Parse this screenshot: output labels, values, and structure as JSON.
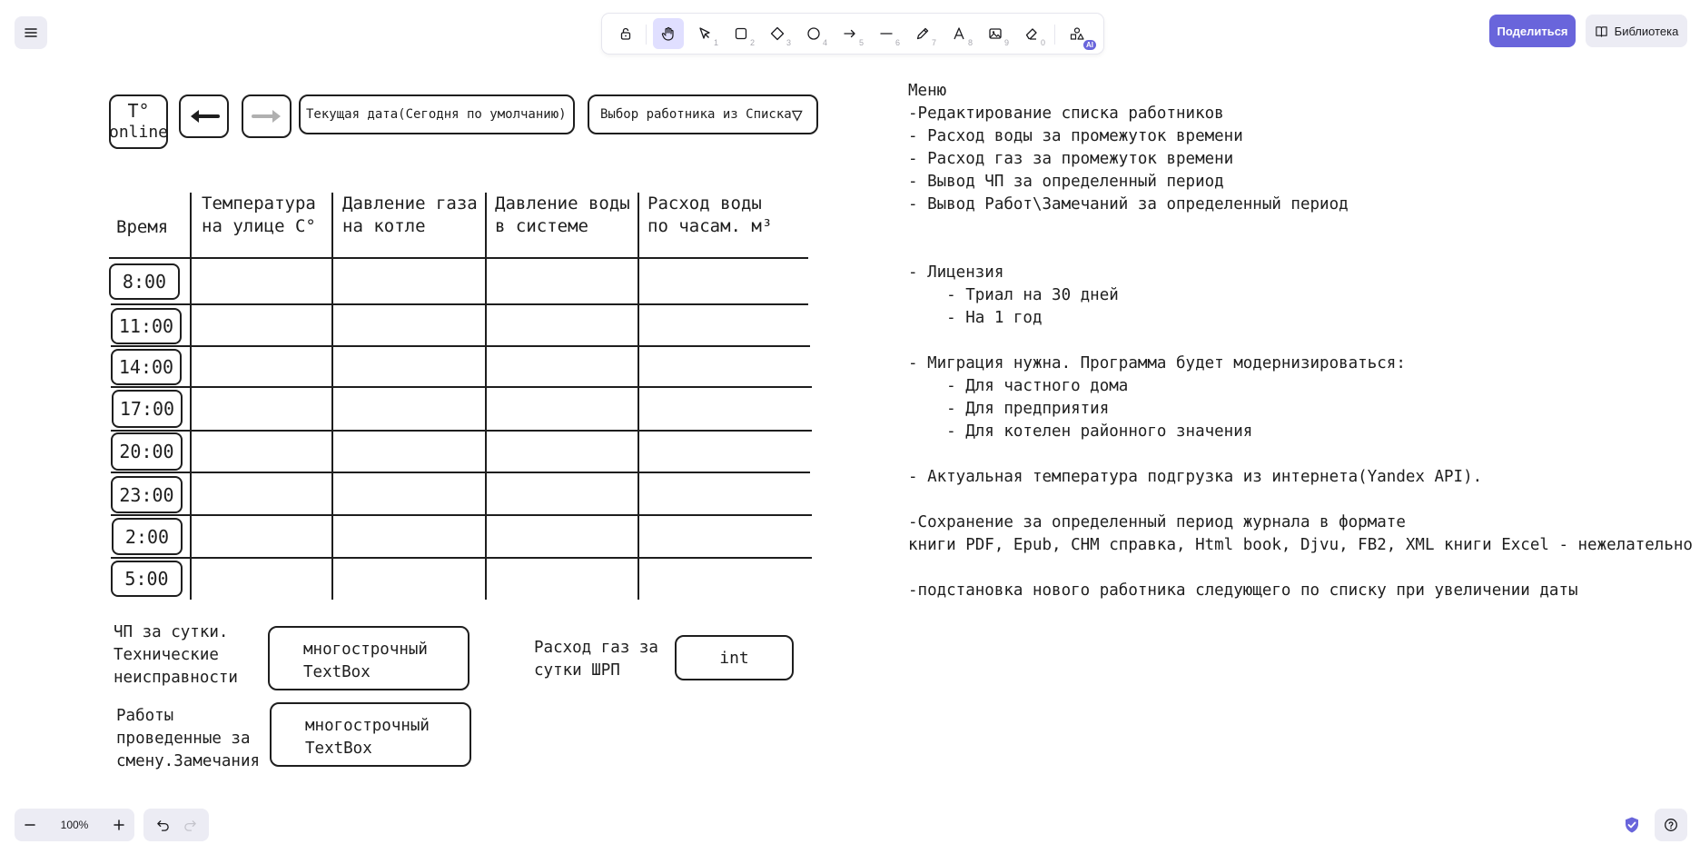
{
  "app": {
    "share_label": "Поделиться",
    "library_label": "Библиотека",
    "zoom": "100%",
    "accent": "#6965db"
  },
  "toolbar": {
    "tools": [
      {
        "name": "lock-icon",
        "key": ""
      },
      {
        "name": "hand-icon",
        "key": ""
      },
      {
        "name": "select-icon",
        "key": "1"
      },
      {
        "name": "rectangle-icon",
        "key": "2"
      },
      {
        "name": "diamond-icon",
        "key": "3"
      },
      {
        "name": "ellipse-icon",
        "key": "4"
      },
      {
        "name": "arrow-icon",
        "key": "5"
      },
      {
        "name": "line-icon",
        "key": "6"
      },
      {
        "name": "pencil-icon",
        "key": "7"
      },
      {
        "name": "text-icon",
        "key": "8"
      },
      {
        "name": "image-icon",
        "key": "9"
      },
      {
        "name": "eraser-icon",
        "key": "0"
      },
      {
        "name": "shapes-ai-icon",
        "key": ""
      }
    ],
    "ai_badge": "AI"
  },
  "canvas": {
    "top_controls": {
      "temp_online_line1": "T°",
      "temp_online_line2": "online",
      "date_field": "Текущая дата(Сегодня по умолчанию)",
      "worker_select": "Выбор работника из Списка",
      "worker_select_arrow": "▽"
    },
    "table": {
      "headers": [
        "Время",
        "Температура\nна улице C°",
        "Давление газа\nна котле",
        "Давление воды\nв системе",
        "Расход воды\nпо часам. м³"
      ],
      "times": [
        "8:00",
        "11:00",
        "14:00",
        "17:00",
        "20:00",
        "23:00",
        "2:00",
        "5:00"
      ]
    },
    "bottom": {
      "incidents_label": "ЧП за сутки.\nТехнические\nнеисправности",
      "incidents_box": "многострочный\nTextBox",
      "works_label": "Работы\nпроведенные за\nсмену.Замечания",
      "works_box": "многострочный\nTextBox",
      "gas_label": "Расход газ за\nсутки ШРП",
      "gas_box": "int"
    },
    "notes": [
      "Меню",
      "-Редактирование списка работников",
      "- Расход воды за промежуток времени",
      "- Расход газ за промежуток времени",
      "- Вывод ЧП за определенный период",
      "- Вывод Работ\\Замечаний за определенный период",
      "",
      "",
      "- Лицензия",
      "    - Триал на 30 дней",
      "    - На 1 год",
      "",
      "- Миграция нужна. Программа будет модернизироваться:",
      "    - Для частного дома",
      "    - Для предприятия",
      "    - Для котелен районного значения",
      "",
      "- Актуальная температура подгрузка из интернета(Yandex API).",
      "",
      "-Сохранение за определенный период журнала в формате",
      "книги PDF, Epub, CHM справка, Html book, Djvu, FB2, XML книги Excel - нежелательно",
      "",
      "-подстановка нового работника следующего по списку при увеличении даты"
    ]
  }
}
